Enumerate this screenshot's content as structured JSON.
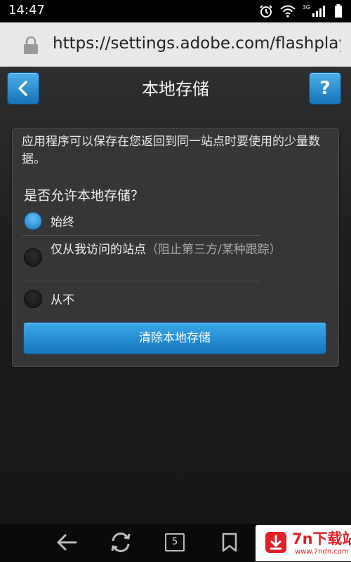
{
  "status_bar": {
    "time": "14:47",
    "network_label": "3G"
  },
  "url_bar": {
    "url": "https://settings.adobe.com/flashplaye.."
  },
  "header": {
    "title": "本地存储",
    "help_label": "?"
  },
  "panel": {
    "description": "应用程序可以保存在您返回到同一站点时要使用的少量数据。",
    "question": "是否允许本地存储？",
    "options": [
      {
        "label": "始终",
        "note": "",
        "selected": true
      },
      {
        "label": "仅从我访问的站点",
        "note": "（阻止第三方/某种跟踪）",
        "selected": false
      },
      {
        "label": "从不",
        "note": "",
        "selected": false
      }
    ],
    "clear_button": "清除本地存储"
  },
  "bottom_nav": {
    "tab_count": "5"
  },
  "watermark": {
    "title": "7n下载站",
    "url": "www.7ndn.com"
  },
  "colors": {
    "accent": "#1a80c8",
    "background": "#1a1a1a"
  }
}
